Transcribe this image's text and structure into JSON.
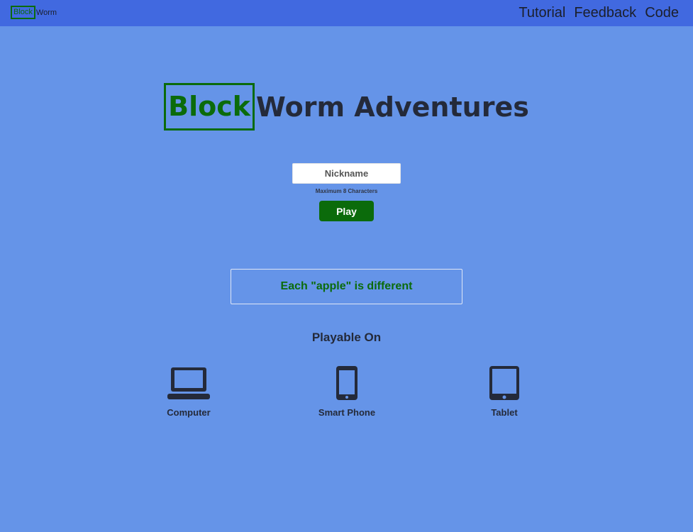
{
  "header": {
    "brand_block": "Block",
    "brand_worm": "Worm",
    "nav": {
      "tutorial": "Tutorial",
      "feedback": "Feedback",
      "code": "Code"
    }
  },
  "title": {
    "block": "Block",
    "rest": "Worm Adventures"
  },
  "form": {
    "nickname_placeholder": "Nickname",
    "max_chars_note": "Maximum 8 Characters",
    "play_label": "Play"
  },
  "tip": {
    "text": "Each \"apple\" is different"
  },
  "playable": {
    "heading": "Playable On",
    "devices": [
      {
        "label": "Computer",
        "icon": "laptop-icon"
      },
      {
        "label": "Smart Phone",
        "icon": "smartphone-icon"
      },
      {
        "label": "Tablet",
        "icon": "tablet-icon"
      }
    ]
  },
  "colors": {
    "background": "#6594e8",
    "topbar": "#4169e0",
    "accent_green": "#0b6b0b",
    "text_dark": "#242a3a"
  }
}
